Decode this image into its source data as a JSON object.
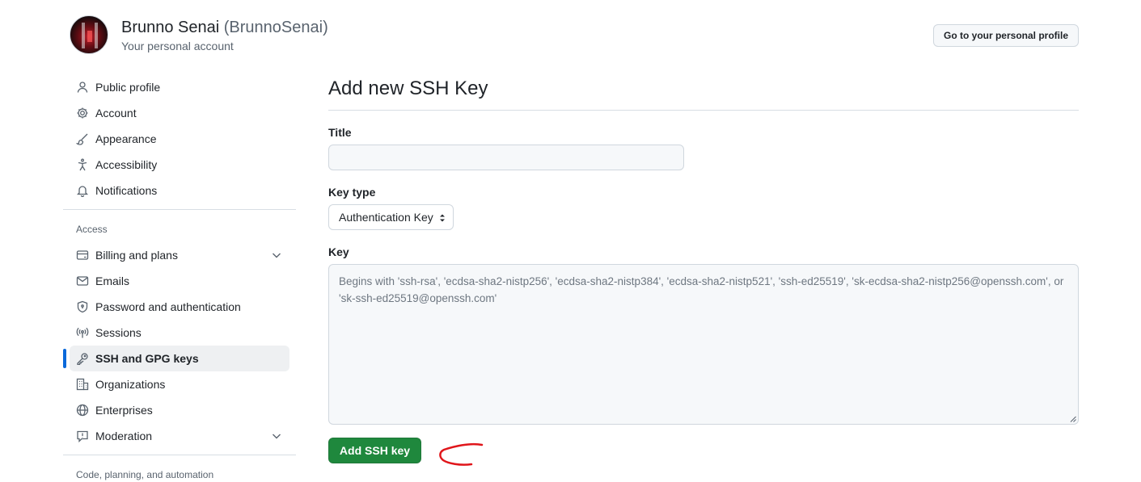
{
  "header": {
    "display_name": "Brunno Senai",
    "handle": "(BrunnoSenai)",
    "subtitle": "Your personal account",
    "profile_button_label": "Go to your personal profile"
  },
  "sidebar": {
    "top_items": [
      {
        "label": "Public profile",
        "icon": "person-icon"
      },
      {
        "label": "Account",
        "icon": "gear-icon"
      },
      {
        "label": "Appearance",
        "icon": "paintbrush-icon"
      },
      {
        "label": "Accessibility",
        "icon": "accessibility-icon"
      },
      {
        "label": "Notifications",
        "icon": "bell-icon"
      }
    ],
    "access_title": "Access",
    "access_items": [
      {
        "label": "Billing and plans",
        "icon": "credit-card-icon",
        "expandable": true
      },
      {
        "label": "Emails",
        "icon": "mail-icon"
      },
      {
        "label": "Password and authentication",
        "icon": "shield-lock-icon"
      },
      {
        "label": "Sessions",
        "icon": "broadcast-icon"
      },
      {
        "label": "SSH and GPG keys",
        "icon": "key-icon",
        "selected": true
      },
      {
        "label": "Organizations",
        "icon": "organization-icon"
      },
      {
        "label": "Enterprises",
        "icon": "globe-icon"
      },
      {
        "label": "Moderation",
        "icon": "report-icon",
        "expandable": true
      }
    ],
    "code_section_title": "Code, planning, and automation"
  },
  "main": {
    "page_title": "Add new SSH Key",
    "title_label": "Title",
    "title_value": "",
    "key_type_label": "Key type",
    "key_type_selected": "Authentication Key",
    "key_label": "Key",
    "key_placeholder": "Begins with 'ssh-rsa', 'ecdsa-sha2-nistp256', 'ecdsa-sha2-nistp384', 'ecdsa-sha2-nistp521', 'ssh-ed25519', 'sk-ecdsa-sha2-nistp256@openssh.com', or 'sk-ssh-ed25519@openssh.com'",
    "submit_label": "Add SSH key"
  },
  "colors": {
    "accent_blue": "#0969da",
    "primary_green": "#1f883d",
    "annotation_red": "#e0161b"
  }
}
